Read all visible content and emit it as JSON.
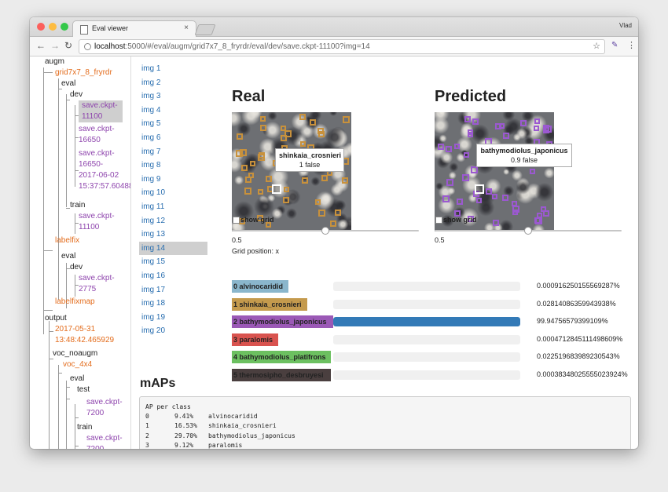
{
  "browser": {
    "tab_title": "Eval viewer",
    "tab_close": "×",
    "profile": "Vlad",
    "back": "←",
    "forward": "→",
    "reload": "↻",
    "url_host": "localhost",
    "url_rest": ":5000/#/eval/augm/grid7x7_8_fryrdr/eval/dev/save.ckpt-11100?img=14",
    "star": "☆",
    "extension": "✎",
    "menu": "⋮"
  },
  "tree": [
    {
      "text": "augm",
      "style": "plain"
    },
    {
      "text": "grid7x7_8_fryrdr",
      "style": "orange"
    },
    {
      "text": "eval",
      "style": "plain"
    },
    {
      "text": "dev",
      "style": "plain"
    },
    {
      "text": "save.ckpt-",
      "style": "purple"
    },
    {
      "text": "11100",
      "style": "purple"
    },
    {
      "text": "save.ckpt-",
      "style": "purple"
    },
    {
      "text": "16650",
      "style": "purple"
    },
    {
      "text": "save.ckpt-",
      "style": "purple"
    },
    {
      "text": "16650-",
      "style": "purple"
    },
    {
      "text": "2017-06-02",
      "style": "purple"
    },
    {
      "text": "15:37:57.60488",
      "style": "purple"
    },
    {
      "text": "train",
      "style": "plain"
    },
    {
      "text": "save.ckpt-",
      "style": "purple"
    },
    {
      "text": "11100",
      "style": "purple"
    },
    {
      "text": "labelfix",
      "style": "orange"
    },
    {
      "text": "eval",
      "style": "plain"
    },
    {
      "text": "dev",
      "style": "plain"
    },
    {
      "text": "save.ckpt-",
      "style": "purple"
    },
    {
      "text": "2775",
      "style": "purple"
    },
    {
      "text": "labelfixmap",
      "style": "orange"
    },
    {
      "text": "output",
      "style": "plain"
    },
    {
      "text": "2017-05-31",
      "style": "orange"
    },
    {
      "text": "13:48:42.465929",
      "style": "orange"
    },
    {
      "text": "voc_noaugm",
      "style": "plain"
    },
    {
      "text": "voc_4x4",
      "style": "orange"
    },
    {
      "text": "eval",
      "style": "plain"
    },
    {
      "text": "test",
      "style": "plain"
    },
    {
      "text": "save.ckpt-",
      "style": "purple"
    },
    {
      "text": "7200",
      "style": "purple"
    },
    {
      "text": "train",
      "style": "plain"
    },
    {
      "text": "save.ckpt-",
      "style": "purple"
    },
    {
      "text": "7200",
      "style": "purple"
    }
  ],
  "images": [
    "img 1",
    "img 2",
    "img 3",
    "img 4",
    "img 5",
    "img 6",
    "img 7",
    "img 8",
    "img 9",
    "img 10",
    "img 11",
    "img 12",
    "img 13",
    "img 14",
    "img 15",
    "img 16",
    "img 17",
    "img 18",
    "img 19",
    "img 20"
  ],
  "selected_image_index": 13,
  "real": {
    "title": "Real",
    "tooltip_class": "shinkaia_crosnieri",
    "tooltip_value": "1 false",
    "show_grid": "show grid",
    "slider_value": "0.5",
    "slider_fraction": 0.5,
    "grid_position": "Grid position: x",
    "box_color": "#c8913c"
  },
  "predicted": {
    "title": "Predicted",
    "tooltip_class": "bathymodiolus_japonicus",
    "tooltip_value": "0.9 false",
    "show_grid": "show grid",
    "slider_value": "0.5",
    "slider_fraction": 0.5,
    "box_color": "#9b59d0"
  },
  "classes": [
    {
      "label": "0 alvinocaridid",
      "color": "#8ab6cc",
      "prob": "0.0009162501555692​87%",
      "fraction": 9.2e-06
    },
    {
      "label": "1 shinkaia_crosnieri",
      "color": "#c49a4d",
      "prob": "0.0281408635994​3938%",
      "fraction": 0.00028
    },
    {
      "label": "2 bathymodiolus_japonicus",
      "color": "#9b59b6",
      "prob": "99.94756579399109%",
      "fraction": 0.9994756579
    },
    {
      "label": "3 paralomis",
      "color": "#d9534f",
      "prob": "0.0004712845111498609%",
      "fraction": 4.7e-06
    },
    {
      "label": "4 bathymodiolus_platifrons",
      "color": "#6cc060",
      "prob": "0.0225196839892305​43%",
      "fraction": 0.000225
    },
    {
      "label": "5 thermosipho_desbruyesi",
      "color": "#4a3f3f",
      "prob": "0.0003834802555502​3924%",
      "fraction": 3.8e-06
    }
  ],
  "maps": {
    "title": "mAPs",
    "header": "AP per class",
    "rows": [
      {
        "idx": "0",
        "ap": "9.41%",
        "name": "alvinocaridid"
      },
      {
        "idx": "1",
        "ap": "16.53%",
        "name": "shinkaia_crosnieri"
      },
      {
        "idx": "2",
        "ap": "29.70%",
        "name": "bathymodiolus_japonicus"
      },
      {
        "idx": "3",
        "ap": "9.12%",
        "name": "paralomis"
      }
    ]
  }
}
